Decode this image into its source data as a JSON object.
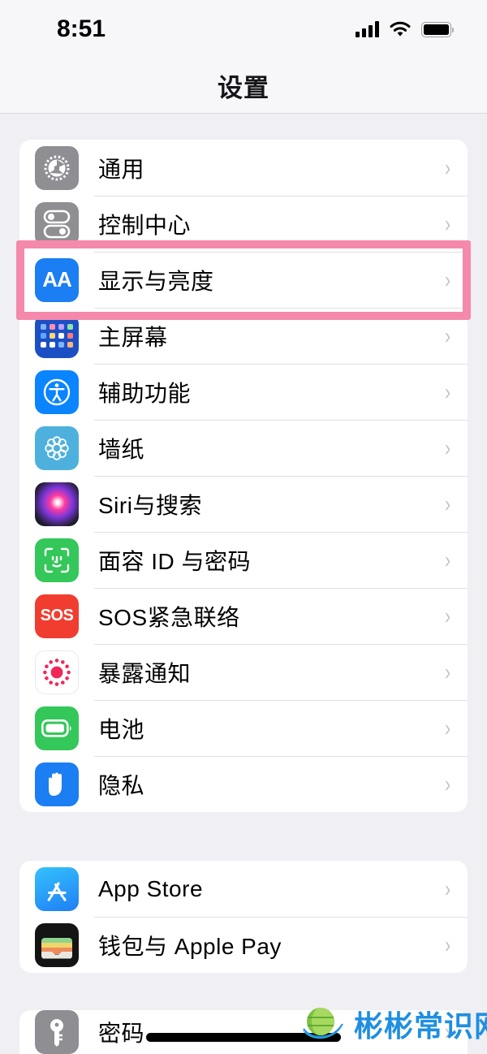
{
  "status_bar": {
    "time": "8:51",
    "signal_icon": "cellular-signal-icon",
    "wifi_icon": "wifi-icon",
    "battery_icon": "battery-full-icon"
  },
  "nav": {
    "title": "设置"
  },
  "groups": [
    {
      "id": "group1",
      "rows": [
        {
          "label": "通用",
          "icon": "gear-icon",
          "icon_class": "ic-gear"
        },
        {
          "label": "控制中心",
          "icon": "control-center-icon",
          "icon_class": "ic-control"
        },
        {
          "label": "显示与亮度",
          "icon": "display-brightness-icon",
          "icon_class": "ic-display"
        },
        {
          "label": "主屏幕",
          "icon": "home-screen-icon",
          "icon_class": "ic-home"
        },
        {
          "label": "辅助功能",
          "icon": "accessibility-icon",
          "icon_class": "ic-access"
        },
        {
          "label": "墙纸",
          "icon": "wallpaper-icon",
          "icon_class": "ic-wallpaper"
        },
        {
          "label": "Siri与搜索",
          "icon": "siri-icon",
          "icon_class": "ic-siri"
        },
        {
          "label": "面容 ID 与密码",
          "icon": "face-id-icon",
          "icon_class": "ic-faceid"
        },
        {
          "label": "SOS紧急联络",
          "icon": "sos-icon",
          "icon_class": "ic-sos"
        },
        {
          "label": "暴露通知",
          "icon": "exposure-notification-icon",
          "icon_class": "ic-exposure"
        },
        {
          "label": "电池",
          "icon": "battery-icon",
          "icon_class": "ic-battery"
        },
        {
          "label": "隐私",
          "icon": "privacy-hand-icon",
          "icon_class": "ic-privacy"
        }
      ]
    },
    {
      "id": "group2",
      "rows": [
        {
          "label": "App Store",
          "icon": "app-store-icon",
          "icon_class": "ic-appstore"
        },
        {
          "label": "钱包与 Apple Pay",
          "icon": "wallet-icon",
          "icon_class": "ic-wallet"
        }
      ]
    },
    {
      "id": "group3",
      "rows": [
        {
          "label": "密码",
          "icon": "key-icon",
          "icon_class": "ic-key"
        }
      ]
    }
  ],
  "highlight": {
    "target_label": "显示与亮度",
    "color": "#f589ab"
  },
  "watermark": {
    "text": "彬彬常识网",
    "logo_icon": "globe-logo-icon",
    "color": "#1f8fe0"
  },
  "chevron": "›",
  "display_icon_text": "AA",
  "sos_icon_text": "SOS",
  "colors": {
    "background": "#efeff4",
    "card": "#ffffff",
    "separator": "#e0e0e3",
    "chevron": "#c3c3c7",
    "nav_bar": "#f7f7fa"
  }
}
